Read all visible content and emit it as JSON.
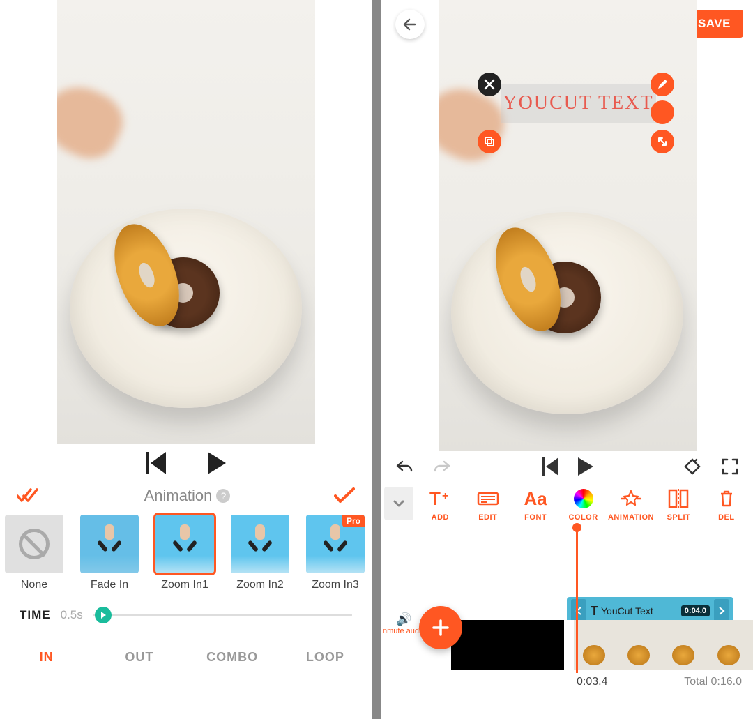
{
  "left": {
    "panel_title": "Animation",
    "options": [
      {
        "label": "None",
        "kind": "none"
      },
      {
        "label": "Fade In",
        "kind": "fade"
      },
      {
        "label": "Zoom In1",
        "kind": "zoom",
        "selected": true
      },
      {
        "label": "Zoom In2",
        "kind": "zoom"
      },
      {
        "label": "Zoom In3",
        "kind": "zoom",
        "pro": true
      }
    ],
    "pro_badge": "Pro",
    "time_label": "TIME",
    "time_value": "0.5s",
    "tabs": [
      "IN",
      "OUT",
      "COMBO",
      "LOOP"
    ],
    "active_tab": "IN"
  },
  "right": {
    "save_label": "SAVE",
    "overlay_text": "YOUCUT TEXT",
    "tools": [
      {
        "key": "add",
        "label": "ADD"
      },
      {
        "key": "edit",
        "label": "EDIT"
      },
      {
        "key": "font",
        "label": "FONT"
      },
      {
        "key": "color",
        "label": "COLOR"
      },
      {
        "key": "animation",
        "label": "ANIMATION"
      },
      {
        "key": "split",
        "label": "SPLIT"
      },
      {
        "key": "del",
        "label": "DEL"
      }
    ],
    "textclip": {
      "label": "YouCut Text",
      "duration_badge": "0:04.0"
    },
    "audio_label": "nmute\naudio",
    "current_time": "0:03.4",
    "total_label": "Total",
    "total_time": "0:16.0"
  },
  "colors": {
    "accent": "#ff5722"
  }
}
